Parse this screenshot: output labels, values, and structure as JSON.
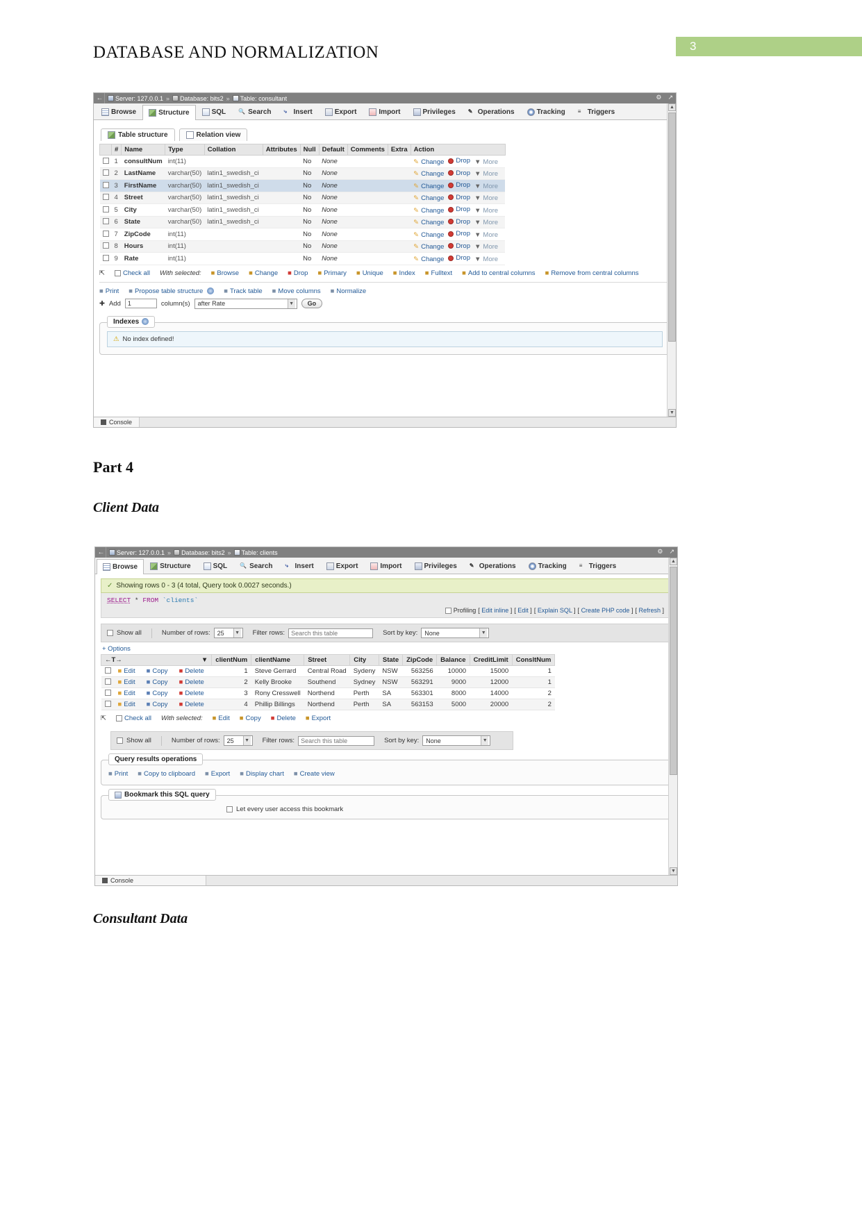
{
  "document": {
    "title": "DATABASE AND NORMALIZATION",
    "page_number": "3",
    "page_badge_color": "#aed087",
    "headings": {
      "part": "Part 4",
      "client_data": "Client Data",
      "consultant_data": "Consultant Data"
    }
  },
  "window1": {
    "breadcrumb": {
      "back_arrow": "←",
      "server": "Server: 127.0.0.1",
      "database": "Database: bits2",
      "table": "Table: consultant",
      "separator": "»",
      "gear_icon": "gear-icon",
      "collapse_icon": "collapse-icon"
    },
    "tabs": [
      {
        "label": "Browse",
        "icon": "browse-icon",
        "active": false
      },
      {
        "label": "Structure",
        "icon": "structure-icon",
        "active": true
      },
      {
        "label": "SQL",
        "icon": "sql-icon",
        "active": false
      },
      {
        "label": "Search",
        "icon": "search-icon",
        "active": false
      },
      {
        "label": "Insert",
        "icon": "insert-icon",
        "active": false
      },
      {
        "label": "Export",
        "icon": "export-icon",
        "active": false
      },
      {
        "label": "Import",
        "icon": "import-icon",
        "active": false
      },
      {
        "label": "Privileges",
        "icon": "privileges-icon",
        "active": false
      },
      {
        "label": "Operations",
        "icon": "operations-icon",
        "active": false
      },
      {
        "label": "Tracking",
        "icon": "tracking-icon",
        "active": false
      },
      {
        "label": "Triggers",
        "icon": "triggers-icon",
        "active": false
      }
    ],
    "subtabs": [
      {
        "label": "Table structure",
        "active": true
      },
      {
        "label": "Relation view",
        "active": false
      }
    ],
    "structure_table": {
      "headers": [
        "",
        "#",
        "Name",
        "Type",
        "Collation",
        "Attributes",
        "Null",
        "Default",
        "Comments",
        "Extra",
        "Action"
      ],
      "rows": [
        {
          "num": "1",
          "name": "consultNum",
          "type": "int(11)",
          "collation": "",
          "attributes": "",
          "null": "No",
          "default": "None",
          "comments": "",
          "extra": ""
        },
        {
          "num": "2",
          "name": "LastName",
          "type": "varchar(50)",
          "collation": "latin1_swedish_ci",
          "attributes": "",
          "null": "No",
          "default": "None",
          "comments": "",
          "extra": ""
        },
        {
          "num": "3",
          "name": "FirstName",
          "type": "varchar(50)",
          "collation": "latin1_swedish_ci",
          "attributes": "",
          "null": "No",
          "default": "None",
          "comments": "",
          "extra": ""
        },
        {
          "num": "4",
          "name": "Street",
          "type": "varchar(50)",
          "collation": "latin1_swedish_ci",
          "attributes": "",
          "null": "No",
          "default": "None",
          "comments": "",
          "extra": ""
        },
        {
          "num": "5",
          "name": "City",
          "type": "varchar(50)",
          "collation": "latin1_swedish_ci",
          "attributes": "",
          "null": "No",
          "default": "None",
          "comments": "",
          "extra": ""
        },
        {
          "num": "6",
          "name": "State",
          "type": "varchar(50)",
          "collation": "latin1_swedish_ci",
          "attributes": "",
          "null": "No",
          "default": "None",
          "comments": "",
          "extra": ""
        },
        {
          "num": "7",
          "name": "ZipCode",
          "type": "int(11)",
          "collation": "",
          "attributes": "",
          "null": "No",
          "default": "None",
          "comments": "",
          "extra": ""
        },
        {
          "num": "8",
          "name": "Hours",
          "type": "int(11)",
          "collation": "",
          "attributes": "",
          "null": "No",
          "default": "None",
          "comments": "",
          "extra": ""
        },
        {
          "num": "9",
          "name": "Rate",
          "type": "int(11)",
          "collation": "",
          "attributes": "",
          "null": "No",
          "default": "None",
          "comments": "",
          "extra": ""
        }
      ],
      "row_actions": {
        "change": "Change",
        "drop": "Drop",
        "more": "More"
      }
    },
    "with_selected": {
      "check_all": "Check all",
      "label": "With selected:",
      "actions": [
        "Browse",
        "Change",
        "Drop",
        "Primary",
        "Unique",
        "Index",
        "Fulltext",
        "Add to central columns",
        "Remove from central columns"
      ]
    },
    "table_ops": [
      "Print",
      "Propose table structure",
      "Track table",
      "Move columns",
      "Normalize"
    ],
    "add_column": {
      "label": "Add",
      "count": "1",
      "columns_label": "column(s)",
      "position": "after Rate",
      "go": "Go"
    },
    "indexes": {
      "legend": "Indexes",
      "notice": "No index defined!"
    },
    "console": "Console"
  },
  "window2": {
    "breadcrumb": {
      "back_arrow": "←",
      "server": "Server: 127.0.0.1",
      "database": "Database: bits2",
      "table": "Table: clients",
      "separator": "»",
      "gear_icon": "gear-icon",
      "collapse_icon": "collapse-icon"
    },
    "tabs": [
      {
        "label": "Browse",
        "icon": "browse-icon",
        "active": true
      },
      {
        "label": "Structure",
        "icon": "structure-icon",
        "active": false
      },
      {
        "label": "SQL",
        "icon": "sql-icon",
        "active": false
      },
      {
        "label": "Search",
        "icon": "search-icon",
        "active": false
      },
      {
        "label": "Insert",
        "icon": "insert-icon",
        "active": false
      },
      {
        "label": "Export",
        "icon": "export-icon",
        "active": false
      },
      {
        "label": "Import",
        "icon": "import-icon",
        "active": false
      },
      {
        "label": "Privileges",
        "icon": "privileges-icon",
        "active": false
      },
      {
        "label": "Operations",
        "icon": "operations-icon",
        "active": false
      },
      {
        "label": "Tracking",
        "icon": "tracking-icon",
        "active": false
      },
      {
        "label": "Triggers",
        "icon": "triggers-icon",
        "active": false
      }
    ],
    "status": "Showing rows 0 - 3 (4 total, Query took 0.0027 seconds.)",
    "sql": {
      "keyword1": "SELECT",
      "star": "*",
      "keyword2": "FROM",
      "table": "`clients`"
    },
    "sql_links": {
      "profiling": "Profiling",
      "items": [
        "Edit inline",
        "Edit",
        "Explain SQL",
        "Create PHP code",
        "Refresh"
      ]
    },
    "toolbar_top": {
      "show_all": "Show all",
      "number_of_rows_label": "Number of rows:",
      "number_of_rows": "25",
      "filter_label": "Filter rows:",
      "filter_placeholder": "Search this table",
      "sort_label": "Sort by key:",
      "sort_value": "None"
    },
    "options_link": "+ Options",
    "data_table": {
      "action_header": "←T→",
      "headers": [
        "clientNum",
        "clientName",
        "Street",
        "City",
        "State",
        "ZipCode",
        "Balance",
        "CreditLimit",
        "ConsltNum"
      ],
      "row_actions": [
        "Edit",
        "Copy",
        "Delete"
      ],
      "rows": [
        {
          "clientNum": "1",
          "clientName": "Steve Gerrard",
          "Street": "Central Road",
          "City": "Sydeny",
          "State": "NSW",
          "ZipCode": "563256",
          "Balance": "10000",
          "CreditLimit": "15000",
          "ConsltNum": "1"
        },
        {
          "clientNum": "2",
          "clientName": "Kelly Brooke",
          "Street": "Southend",
          "City": "Sydney",
          "State": "NSW",
          "ZipCode": "563291",
          "Balance": "9000",
          "CreditLimit": "12000",
          "ConsltNum": "1"
        },
        {
          "clientNum": "3",
          "clientName": "Rony Cresswell",
          "Street": "Northend",
          "City": "Perth",
          "State": "SA",
          "ZipCode": "563301",
          "Balance": "8000",
          "CreditLimit": "14000",
          "ConsltNum": "2"
        },
        {
          "clientNum": "4",
          "clientName": "Phillip Billings",
          "Street": "Northend",
          "City": "Perth",
          "State": "SA",
          "ZipCode": "563153",
          "Balance": "5000",
          "CreditLimit": "20000",
          "ConsltNum": "2"
        }
      ]
    },
    "with_selected": {
      "check_all": "Check all",
      "label": "With selected:",
      "actions": [
        "Edit",
        "Copy",
        "Delete",
        "Export"
      ]
    },
    "toolbar_bottom": {
      "show_all": "Show all",
      "number_of_rows_label": "Number of rows:",
      "number_of_rows": "25",
      "filter_label": "Filter rows:",
      "filter_placeholder": "Search this table",
      "sort_label": "Sort by key:",
      "sort_value": "None"
    },
    "query_results_operations": {
      "legend": "Query results operations",
      "items": [
        "Print",
        "Copy to clipboard",
        "Export",
        "Display chart",
        "Create view"
      ]
    },
    "bookmark": {
      "legend": "Bookmark this SQL query",
      "checkbox_label": "Let every user access this bookmark"
    },
    "console": "Console"
  }
}
